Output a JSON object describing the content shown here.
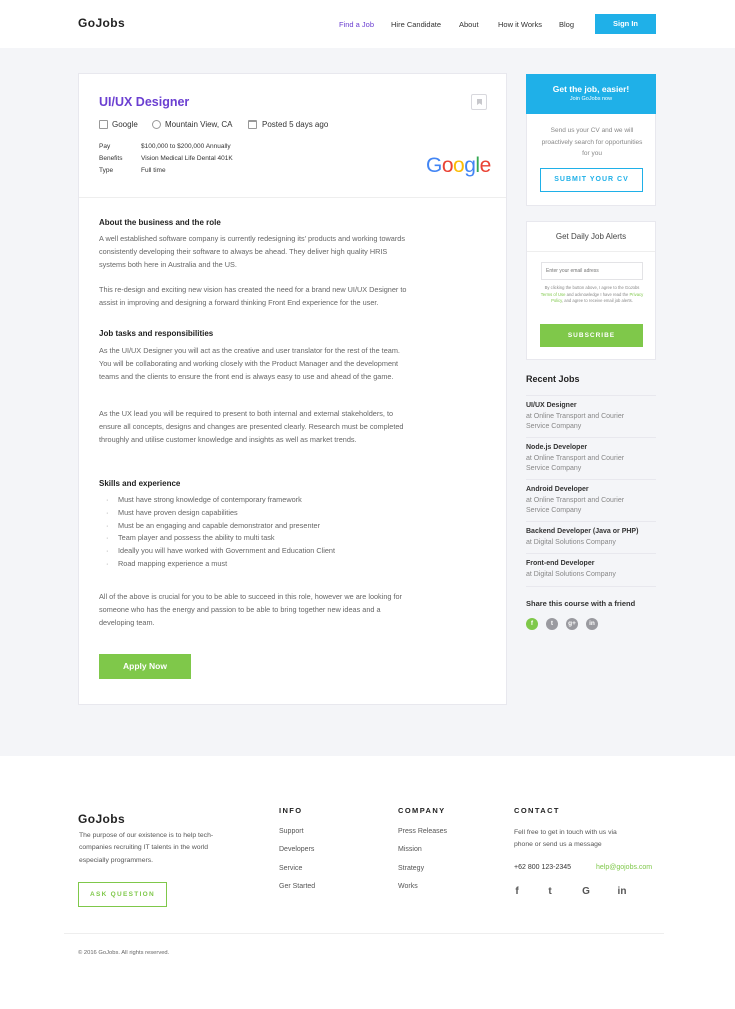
{
  "brand": "GoJobs",
  "nav": {
    "items": [
      "Find a Job",
      "Hire Candidate",
      "About",
      "How it Works",
      "Blog"
    ],
    "sign_in": "Sign In"
  },
  "job": {
    "title": "UI/UX Designer",
    "company": "Google",
    "location": "Mountain View, CA",
    "posted": "Posted 5 days ago",
    "pay_label": "Pay",
    "pay": "$100,000 to $200,000 Annually",
    "benefits_label": "Benefits",
    "benefits": "Vision Medical Life Dental 401K",
    "type_label": "Type",
    "type": "Full time",
    "logo_letters": [
      "G",
      "o",
      "o",
      "g",
      "l",
      "e"
    ],
    "logo_colors": [
      "#4285F4",
      "#EA4335",
      "#FBBC05",
      "#4285F4",
      "#34A853",
      "#EA4335"
    ],
    "about_heading": "About the business and the role",
    "about_p1": "A well established software company is currently redesigning its' products and working towards consistently developing their software to always be ahead. They deliver high quality HRIS systems both here in Australia and the US.",
    "about_p2": "This re-design and exciting new vision has created the need for a brand new UI/UX Designer to assist in improving and designing a forward thinking Front End experience for the user.",
    "tasks_heading": "Job tasks and responsibilities",
    "tasks_p1": "As the UI/UX Designer you will act as the creative and user translator for the rest of the team. You will be collaborating and working closely with the Product Manager and the development teams and the clients to ensure the front end is always easy to use and ahead of the game.",
    "tasks_p2": "As the UX lead you will be required to present to both internal and external stakeholders, to ensure all concepts, designs and changes are presented clearly. Research must be completed throughly and utilise customer knowledge and insights as well as market trends.",
    "skills_heading": "Skills and experience",
    "skills": [
      "Must have strong knowledge of contemporary framework",
      "Must have proven design capabilities",
      "Must be an engaging and capable demonstrator and presenter",
      "Team player and possess the ability to multi task",
      "Ideally you will have worked with Government and Education Client",
      "Road mapping experience a must"
    ],
    "closing": "All of the above is crucial for you to be able to succeed in this role, however we are looking for someone who has the energy and passion to be able to bring together new ideas and a developing team.",
    "apply": "Apply Now"
  },
  "sidebar": {
    "cta_title": "Get the job, easier!",
    "cta_sub": "Join GoJobs now",
    "cta_text": "Send us your CV and we will proactively search for opportunities for you",
    "submit_cv": "SUBMIT YOUR CV",
    "alerts_title": "Get Daily Job Alerts",
    "email_placeholder": "Enter your email adress",
    "fine_1": "By clicking the button above, I agree to the GoJobs",
    "fine_terms": "Terms of Use",
    "fine_2": "and acknowledge I have read the",
    "fine_privacy": "Privacy Policy",
    "fine_3": ", and agree to receive email job alerts.",
    "subscribe": "SUBSCRIBE",
    "recent_heading": "Recent Jobs",
    "recent": [
      {
        "title": "UI/UX Designer",
        "company": "at Online Transport and Courier Service Company"
      },
      {
        "title": "Node.js Developer",
        "company": "at Online Transport and Courier Service Company"
      },
      {
        "title": "Android Developer",
        "company": "at Online Transport and Courier Service Company"
      },
      {
        "title": "Backend Developer (Java or PHP)",
        "company": "at Digital Solutions Company"
      },
      {
        "title": "Front-end Developer",
        "company": "at Digital Solutions Company"
      }
    ],
    "share_heading": "Share this course with a friend",
    "share_glyphs": [
      "f",
      "t",
      "g+",
      "in"
    ]
  },
  "footer": {
    "about": "The purpose of our existence is to help tech-companies recruiting IT talents in the world especially programmers.",
    "ask": "ASK QUESTION",
    "info_heading": "INFO",
    "info_links": [
      "Support",
      "Developers",
      "Service",
      "Ger Started"
    ],
    "company_heading": "COMPANY",
    "company_links": [
      "Press Releases",
      "Mission",
      "Strategy",
      "Works"
    ],
    "contact_heading": "CONTACT",
    "contact_text": "Fell free to get in touch with us via phone or send us a message",
    "phone": "+62 800 123-2345",
    "email": "help@gojobs.com",
    "social_glyphs": [
      "f",
      "t",
      "G",
      "in"
    ],
    "copyright": "© 2016 GoJobs. All rights reserved."
  }
}
